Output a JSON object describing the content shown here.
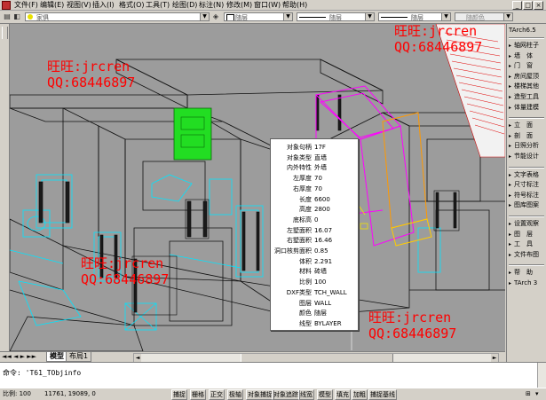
{
  "menu": {
    "items": [
      "文件(F)",
      "编辑(E)",
      "视图(V)",
      "插入(I)",
      "格式(O)",
      "工具(T)",
      "绘图(D)",
      "标注(N)",
      "修改(M)",
      "窗口(W)",
      "帮助(H)"
    ]
  },
  "toolbar": {
    "layer_combo": "家俱",
    "color_combo": "随层",
    "linetype_combo": "随层",
    "lineweight_combo": "随层",
    "plotstyle_combo": "随颜色"
  },
  "watermarks": {
    "name": "旺旺:jrcren",
    "qq": "QQ:68446897"
  },
  "info_panel": {
    "rows": [
      {
        "k": "对象句柄",
        "v": "17F"
      },
      {
        "k": "对象类型",
        "v": "直墙"
      },
      {
        "k": "内外特性",
        "v": "外墙"
      },
      {
        "k": "左厚度",
        "v": "70"
      },
      {
        "k": "右厚度",
        "v": "70"
      },
      {
        "k": "长度",
        "v": "6600"
      },
      {
        "k": "高度",
        "v": "2800"
      },
      {
        "k": "底标高",
        "v": "0"
      },
      {
        "k": "左墅面积",
        "v": "16.07"
      },
      {
        "k": "右墅面积",
        "v": "16.46"
      },
      {
        "k": "洞口核剪面积",
        "v": "0.85"
      },
      {
        "k": "体积",
        "v": "2.291"
      },
      {
        "k": "材料",
        "v": "砖墙"
      },
      {
        "k": "比例",
        "v": "100"
      },
      {
        "k": "DXF类型",
        "v": "TCH_WALL"
      },
      {
        "k": "图层",
        "v": "WALL"
      },
      {
        "k": "颜色",
        "v": "随层"
      },
      {
        "k": "线型",
        "v": "BYLAYER"
      }
    ]
  },
  "right_panel": {
    "title": "TArch6.5",
    "groups": [
      [
        "轴网柱子",
        "墙　体",
        "门　窗",
        "房间屋顶",
        "楼梯其他",
        "造型工具",
        "体量建模"
      ],
      [
        "立　面",
        "剖　面",
        "日照分析",
        "节能设计"
      ],
      [
        "文字表格",
        "尺寸标注",
        "符号标注",
        "图库图案"
      ],
      [
        "设置观察",
        "图　层",
        "工　具",
        "文件布图"
      ],
      [
        "帮　助",
        "TArch 3"
      ]
    ]
  },
  "tabs": {
    "model": "模型",
    "layout": "布局1"
  },
  "command": {
    "prompt": "命令: 'T61_TObjinfo"
  },
  "status": {
    "scale": "比例: 100",
    "coords": "11761, 19089, 0",
    "buttons": [
      "捕捉",
      "栅格",
      "正交",
      "极轴",
      "对象捕捉",
      "对象追踪",
      "线宽",
      "模型",
      "填充",
      "加粗",
      "捕捉基线"
    ]
  },
  "colors": {
    "viewport_bg": "#9c9c9c",
    "watermark": "#ff0000",
    "cyan_lines": "#00e5ff",
    "magenta_lines": "#ff00ff",
    "green_highlight": "#22dd22"
  }
}
